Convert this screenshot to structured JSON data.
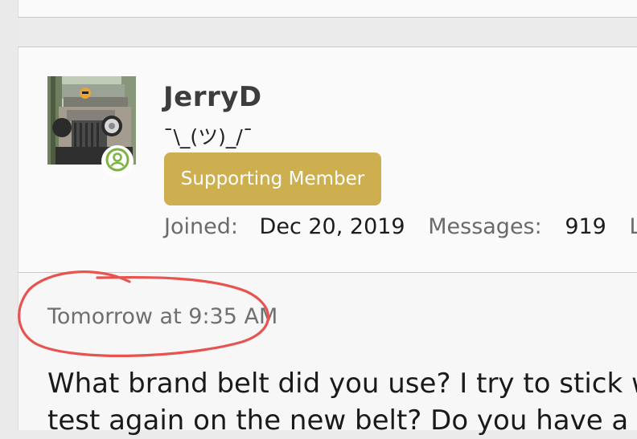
{
  "user": {
    "name": "JerryD",
    "title": "¯\\_(ツ)_/¯",
    "banner": "Supporting Member",
    "stats": {
      "joined_label": "Joined:",
      "joined_value": "Dec 20, 2019",
      "messages_label": "Messages:",
      "messages_value": "919",
      "location_label": "Lo"
    }
  },
  "post": {
    "timestamp": "Tomorrow at 9:35 AM",
    "body_line1": "What brand belt did you use? I try to stick w",
    "body_line2": "test again on the new belt? Do you have a m"
  },
  "colors": {
    "badge": "#cdaf4f",
    "annotation": "#e8534f",
    "online_status": "#7cb342"
  }
}
